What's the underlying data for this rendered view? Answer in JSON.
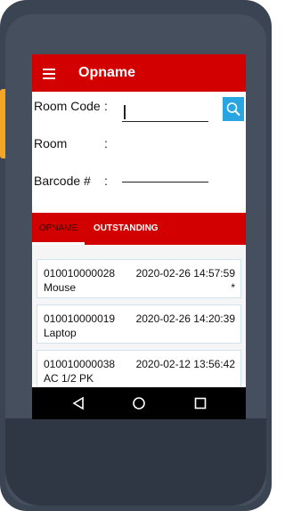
{
  "app": {
    "title": "Opname"
  },
  "form": {
    "room_code_label": "Room Code",
    "room_code_value": "",
    "room_label": "Room",
    "room_value": "",
    "barcode_label": "Barcode #",
    "colon": ":"
  },
  "tabs": [
    {
      "label": "OPNAME",
      "active": true
    },
    {
      "label": "OUTSTANDING",
      "active": false
    }
  ],
  "items": [
    {
      "code": "010010000028",
      "datetime": "2020-02-26 14:57:59",
      "name": "Mouse",
      "mark": "*"
    },
    {
      "code": "010010000019",
      "datetime": "2020-02-26 14:20:39",
      "name": "Laptop",
      "mark": ""
    },
    {
      "code": "010010000038",
      "datetime": "2020-02-12 13:56:42",
      "name": "AC 1/2 PK",
      "mark": ""
    }
  ],
  "colors": {
    "primary": "#d30000",
    "search_button": "#29a6e2",
    "side_button": "#f2a623"
  },
  "icons": {
    "menu": "hamburger-icon",
    "search": "search-icon",
    "nav_back": "triangle-back-icon",
    "nav_home": "circle-home-icon",
    "nav_recents": "square-recents-icon"
  }
}
